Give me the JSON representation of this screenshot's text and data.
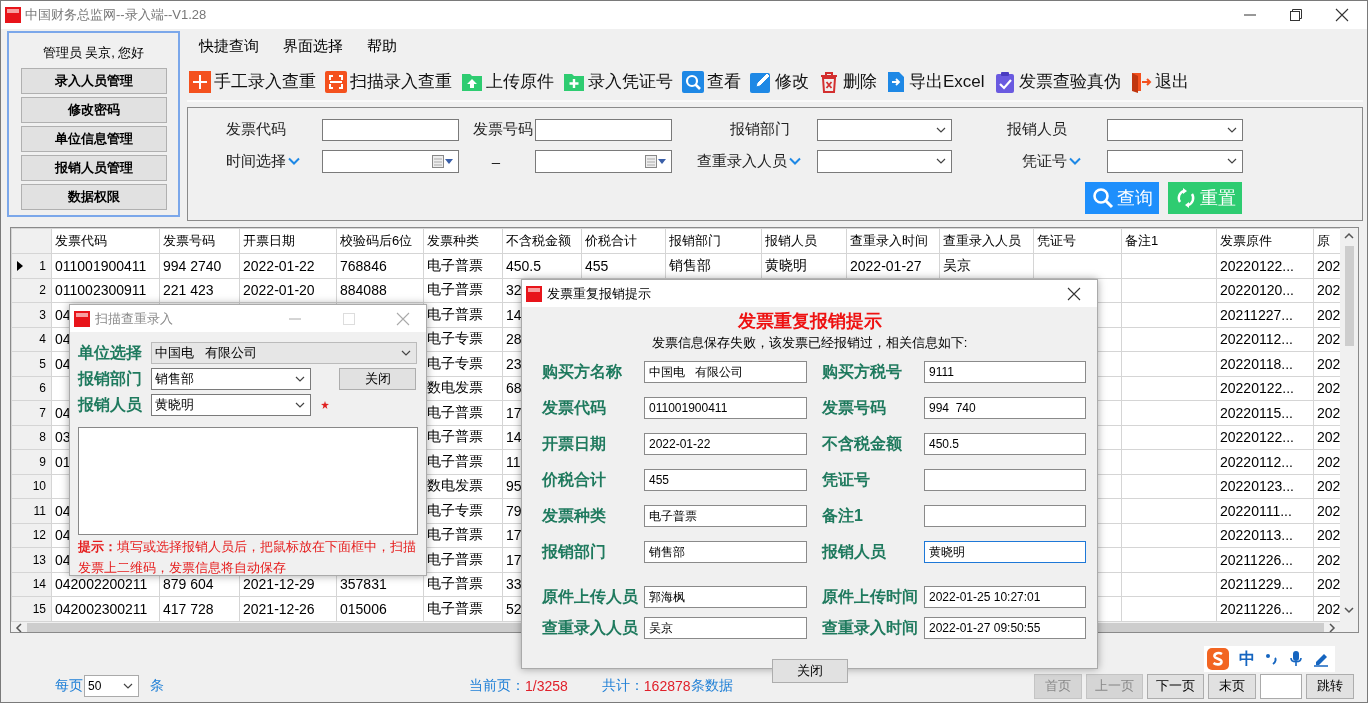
{
  "window": {
    "title": "中国财务总监网--录入端--V1.28"
  },
  "admin_panel": {
    "greeting": "管理员 吴京, 您好",
    "buttons": [
      "录入人员管理",
      "修改密码",
      "单位信息管理",
      "报销人员管理",
      "数据权限"
    ]
  },
  "menu": [
    "快捷查询",
    "界面选择",
    "帮助"
  ],
  "toolbar": [
    "手工录入查重",
    "扫描录入查重",
    "上传原件",
    "录入凭证号",
    "查看",
    "修改",
    "删除",
    "导出Excel",
    "发票查验真伪",
    "退出"
  ],
  "search": {
    "fields": [
      {
        "label": "发票代码",
        "label_menu": false,
        "kind": "text"
      },
      {
        "label": "发票号码",
        "label_menu": false,
        "kind": "text"
      },
      {
        "label": "报销部门",
        "label_menu": false,
        "kind": "combo"
      },
      {
        "label": "报销人员",
        "label_menu": false,
        "kind": "combo"
      },
      {
        "label": "时间选择",
        "label_menu": true,
        "kind": "date"
      },
      {
        "label": "–",
        "label_menu": false,
        "kind": "date"
      },
      {
        "label": "查重录入人员",
        "label_menu": true,
        "kind": "combo"
      },
      {
        "label": "凭证号",
        "label_menu": true,
        "kind": "combo"
      }
    ],
    "buttons": [
      "查询",
      "重置"
    ]
  },
  "table": {
    "columns": [
      "发票代码",
      "发票号码",
      "开票日期",
      "校验码后6位",
      "发票种类",
      "不含税金额",
      "价税合计",
      "报销部门",
      "报销人员",
      "查重录入时间",
      "查重录入人员",
      "凭证号",
      "备注1",
      "发票原件",
      "原"
    ],
    "rows": [
      {
        "num": "1",
        "current": true,
        "cells": [
          "011001900411",
          "994 2740",
          "2022-01-22",
          "768846",
          "电子普票",
          "450.5",
          "455",
          "销售部",
          "黄晓明",
          "2022-01-27",
          "吴京",
          null,
          null,
          "20220122...",
          "202"
        ]
      },
      {
        "num": "2",
        "current": false,
        "cells": [
          "011002300911",
          "221 423",
          "2022-01-20",
          "884088",
          "电子普票",
          "32",
          null,
          null,
          null,
          null,
          null,
          null,
          null,
          "20220120...",
          "202"
        ]
      },
      {
        "num": "3",
        "current": false,
        "cells": [
          "04",
          null,
          null,
          null,
          "电子普票",
          "14",
          null,
          null,
          null,
          null,
          null,
          null,
          null,
          "20211227...",
          "202"
        ]
      },
      {
        "num": "4",
        "current": false,
        "cells": [
          "04",
          null,
          null,
          null,
          "电子专票",
          "28",
          null,
          null,
          null,
          null,
          null,
          null,
          null,
          "20220112...",
          "202"
        ]
      },
      {
        "num": "5",
        "current": false,
        "cells": [
          "04",
          null,
          null,
          null,
          "电子专票",
          "23",
          null,
          null,
          null,
          null,
          null,
          null,
          null,
          "20220118...",
          "202"
        ]
      },
      {
        "num": "6",
        "current": false,
        "cells": [
          null,
          null,
          null,
          null,
          "数电发票",
          "68",
          null,
          null,
          null,
          null,
          null,
          null,
          null,
          "20220122...",
          "202"
        ]
      },
      {
        "num": "7",
        "current": false,
        "cells": [
          "04",
          null,
          null,
          null,
          "电子普票",
          "17",
          null,
          null,
          null,
          null,
          null,
          null,
          null,
          "20220115...",
          "202"
        ]
      },
      {
        "num": "8",
        "current": false,
        "cells": [
          "03",
          null,
          null,
          null,
          "电子普票",
          "14",
          null,
          null,
          null,
          null,
          null,
          null,
          null,
          "20220122...",
          "202"
        ]
      },
      {
        "num": "9",
        "current": false,
        "cells": [
          "01",
          null,
          null,
          null,
          "电子普票",
          "11",
          null,
          null,
          null,
          null,
          null,
          null,
          null,
          "20220112...",
          "202"
        ]
      },
      {
        "num": "10",
        "current": false,
        "cells": [
          null,
          null,
          null,
          null,
          "数电发票",
          "95",
          null,
          null,
          null,
          null,
          null,
          null,
          null,
          "20220123...",
          "202"
        ]
      },
      {
        "num": "11",
        "current": false,
        "cells": [
          "04",
          null,
          null,
          null,
          "电子专票",
          "79",
          null,
          null,
          null,
          null,
          null,
          null,
          null,
          "20220111...",
          "202"
        ]
      },
      {
        "num": "12",
        "current": false,
        "cells": [
          "04",
          null,
          null,
          null,
          "电子普票",
          "17",
          null,
          null,
          null,
          null,
          null,
          null,
          null,
          "20220113...",
          "202"
        ]
      },
      {
        "num": "13",
        "current": false,
        "cells": [
          "04",
          null,
          null,
          null,
          "电子普票",
          "17",
          null,
          null,
          null,
          null,
          null,
          null,
          null,
          "20211226...",
          "202"
        ]
      },
      {
        "num": "14",
        "current": false,
        "cells": [
          "042002200211",
          "879 604",
          "2021-12-29",
          "357831",
          "电子普票",
          "33",
          null,
          null,
          null,
          null,
          null,
          null,
          null,
          "20211229...",
          "202"
        ]
      },
      {
        "num": "15",
        "current": false,
        "cells": [
          "042002300211",
          "417 728",
          "2021-12-26",
          "015006",
          "电子普票",
          "52",
          null,
          null,
          null,
          null,
          null,
          null,
          null,
          "20211226...",
          "202"
        ]
      }
    ]
  },
  "pager": {
    "per_page_label": "每页",
    "per_page": "50",
    "per_page_unit": "条",
    "current_label": "当前页：",
    "current": "1/3258",
    "total_label": "共计：",
    "total": "162878",
    "total_unit": "条数据",
    "buttons": [
      {
        "label": "首页",
        "disabled": true
      },
      {
        "label": "上一页",
        "disabled": true
      },
      {
        "label": "下一页",
        "disabled": false
      },
      {
        "label": "末页",
        "disabled": false
      }
    ],
    "jump": "跳转"
  },
  "scan_dialog": {
    "title": "扫描查重录入",
    "active": false,
    "fields": [
      {
        "label": "单位选择",
        "value": "中国电   有限公司",
        "required": false
      },
      {
        "label": "报销部门",
        "value": "销售部",
        "required": false
      },
      {
        "label": "报销人员",
        "value": "黄晓明",
        "required": true
      }
    ],
    "close": "关闭",
    "tip": "**提示：**填写或选择报销人员后，把鼠标放在下面框中，扫描发票上二维码，发票信息将自动保存"
  },
  "dup_dialog": {
    "title": "发票重复报销提示",
    "active": true,
    "heading": "发票重复报销提示",
    "message": "发票信息保存失败，该发票已经报销过，相关信息如下:",
    "fields": [
      {
        "label": "购买方名称",
        "value": "中国电   有限公司",
        "focused": false
      },
      {
        "label": "购买方税号",
        "value": "9111",
        "focused": false
      },
      {
        "label": "发票代码",
        "value": "011001900411",
        "focused": false
      },
      {
        "label": "发票号码",
        "value": "994  740",
        "focused": false
      },
      {
        "label": "开票日期",
        "value": "2022-01-22",
        "focused": false
      },
      {
        "label": "不含税金额",
        "value": "450.5",
        "focused": false
      },
      {
        "label": "价税合计",
        "value": "455",
        "focused": false
      },
      {
        "label": "凭证号",
        "focused": false
      },
      {
        "label": "发票种类",
        "value": "电子普票",
        "focused": false
      },
      {
        "label": "备注1",
        "focused": false
      },
      {
        "label": "报销部门",
        "value": "销售部",
        "focused": false
      },
      {
        "label": "报销人员",
        "value": "黄晓明",
        "focused": true
      },
      {
        "label": "原件上传人员",
        "value": "郭海枫",
        "focused": false
      },
      {
        "label": "原件上传时间",
        "value": "2022-01-25 10:27:01",
        "focused": false
      },
      {
        "label": "查重录入人员",
        "value": "吴京",
        "focused": false
      },
      {
        "label": "查重录入时间",
        "value": "2022-01-27 09:50:55",
        "focused": false
      }
    ],
    "close": "关闭"
  },
  "ime": {
    "mode": "中"
  }
}
